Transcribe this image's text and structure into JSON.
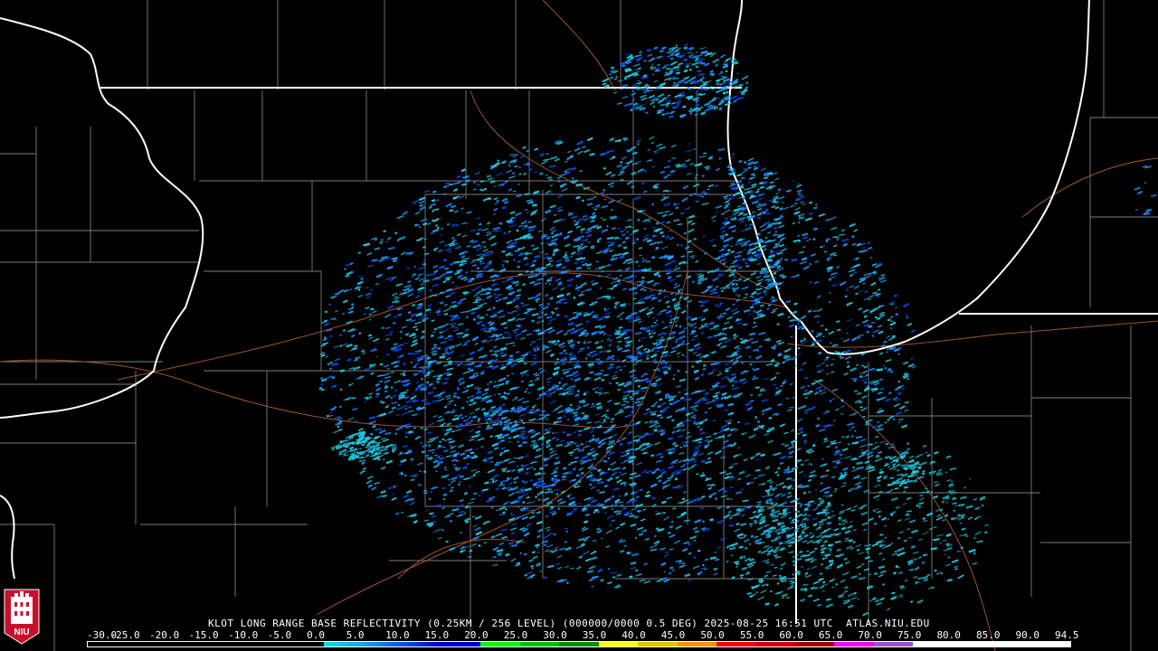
{
  "product": {
    "caption": "KLOT LONG RANGE BASE REFLECTIVITY (0.25KM / 256 LEVEL) (000000/0000 0.5 DEG) 2025-08-25 16:51 UTC  ATLAS.NIU.EDU"
  },
  "scale": {
    "labels": [
      "-30.0",
      "-25.0",
      "-20.0",
      "-15.0",
      "-10.0",
      "-5.0",
      "0.0",
      "5.0",
      "10.0",
      "15.0",
      "20.0",
      "25.0",
      "30.0",
      "35.0",
      "40.0",
      "45.0",
      "50.0",
      "55.0",
      "60.0",
      "65.0",
      "70.0",
      "75.0",
      "80.0",
      "85.0",
      "90.0",
      "94.5"
    ],
    "colors": [
      "#000000",
      "#000000",
      "#000000",
      "#000000",
      "#000000",
      "#000000",
      "#00e5e5",
      "#1ea0f0",
      "#0050ff",
      "#0000c8",
      "#00ff00",
      "#00c000",
      "#008c00",
      "#ffff00",
      "#e7c000",
      "#ff9000",
      "#ff0000",
      "#d00000",
      "#a00000",
      "#ff00ff",
      "#9955c9",
      "#ffffff",
      "#ffffff",
      "#ffffff",
      "#ffffff"
    ]
  },
  "logo": {
    "text": "NIU",
    "color": "#c8102e"
  },
  "colors": {
    "state_border": "#ffffff",
    "county_line": "#8a8a8a",
    "highway": "#a0522d",
    "echo_light": "#22c8e0",
    "echo_mid": "#1e90ff",
    "echo_strong": "#0050ff"
  }
}
